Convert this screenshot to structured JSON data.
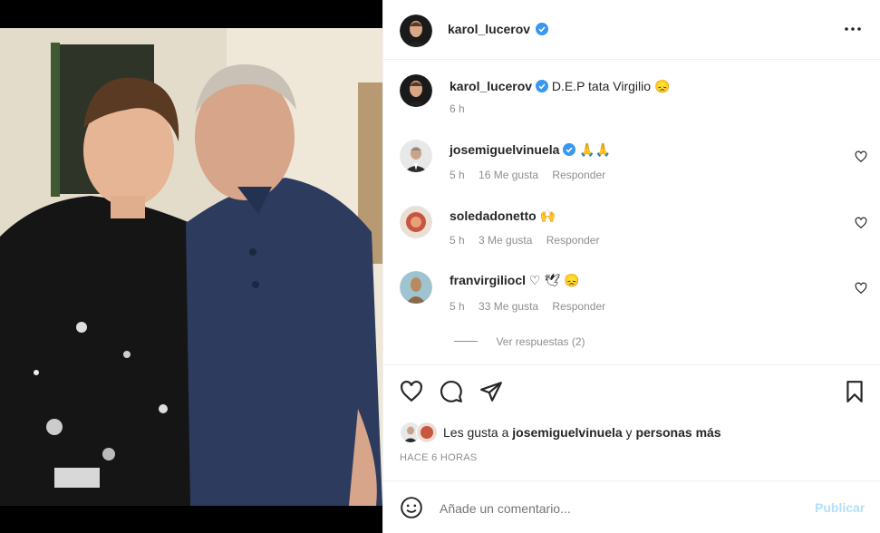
{
  "post": {
    "author": "karol_lucerov",
    "caption": "D.E.P tata Virgilio",
    "caption_emoji": "😞",
    "caption_age": "6 h",
    "more_icon": "more-horizontal-icon"
  },
  "comments": [
    {
      "user": "josemiguelvinuela",
      "verified": true,
      "text": "🙏🙏",
      "age": "5 h",
      "likes": "16 Me gusta",
      "reply": "Responder"
    },
    {
      "user": "soledadonetto",
      "verified": false,
      "text": "🙌",
      "age": "5 h",
      "likes": "3 Me gusta",
      "reply": "Responder"
    },
    {
      "user": "franvirgiliocl",
      "verified": false,
      "text": "♡ 🕊 😞",
      "age": "5 h",
      "likes": "33 Me gusta",
      "reply": "Responder"
    }
  ],
  "view_replies": "Ver respuestas (2)",
  "likes": {
    "prefix": "Les gusta a",
    "user": "josemiguelvinuela",
    "middle": "y",
    "others": "personas más"
  },
  "timestamp": "HACE 6 HORAS",
  "add_comment": {
    "placeholder": "Añade un comentario...",
    "publish": "Publicar"
  },
  "colors": {
    "verified": "#3897f0",
    "publish_disabled": "#b2dffc",
    "muted": "#8e8e8e"
  }
}
